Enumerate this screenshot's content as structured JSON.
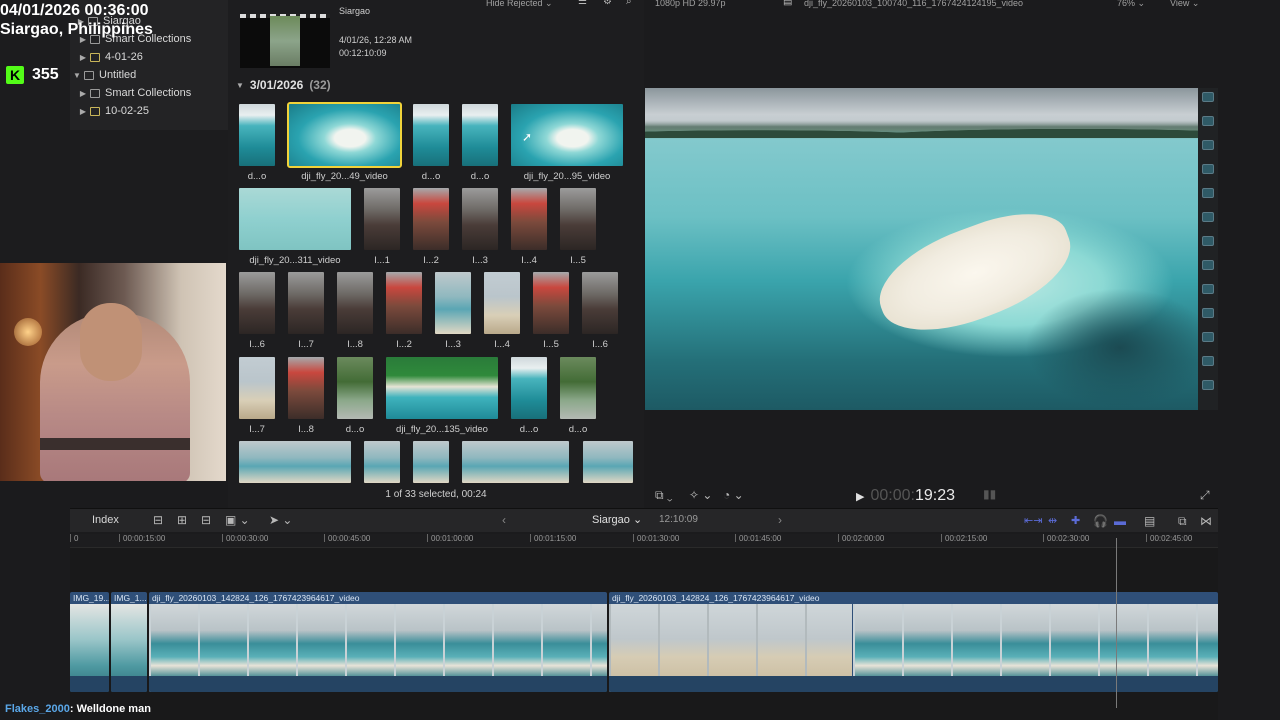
{
  "stream": {
    "date": "04/01/2026 00:36:00",
    "location": "Siargao, Philippines",
    "kick_logo": "K",
    "viewer_count": "355"
  },
  "sidebar": {
    "items": [
      {
        "label": "Siargao",
        "indent": 1
      },
      {
        "label": "Smart Collections",
        "indent": 1
      },
      {
        "label": "4-01-26",
        "indent": 1
      },
      {
        "label": "Untitled",
        "indent": 0
      },
      {
        "label": "Smart Collections",
        "indent": 1
      },
      {
        "label": "10-02-25",
        "indent": 1
      }
    ]
  },
  "browser": {
    "top_bar": {
      "hide_rejected": "Hide Rejected"
    },
    "top_clip": {
      "title": "Siargao",
      "date": "4/01/26, 12:28 AM",
      "duration": "00:12:10:09"
    },
    "date_group": {
      "label": "3/01/2026",
      "count": "(32)"
    },
    "thumbnails": [
      {
        "caption": "d...o"
      },
      {
        "caption": "dji_fly_20...49_video"
      },
      {
        "caption": "d...o"
      },
      {
        "caption": "d...o"
      },
      {
        "caption": "dji_fly_20...95_video"
      },
      {
        "caption": "dji_fly_20...311_video"
      },
      {
        "caption": "I...1"
      },
      {
        "caption": "I...2"
      },
      {
        "caption": "I...3"
      },
      {
        "caption": "I...4"
      },
      {
        "caption": "I...5"
      },
      {
        "caption": "I...6"
      },
      {
        "caption": "I...7"
      },
      {
        "caption": "I...8"
      },
      {
        "caption": "I...2"
      },
      {
        "caption": "I...3"
      },
      {
        "caption": "I...4"
      },
      {
        "caption": "I...5"
      },
      {
        "caption": "I...6"
      },
      {
        "caption": "I...7"
      },
      {
        "caption": "I...8"
      },
      {
        "caption": "d...o"
      },
      {
        "caption": "dji_fly_20...135_video"
      },
      {
        "caption": "d...o"
      },
      {
        "caption": "d...o"
      }
    ],
    "selection_status": "1 of 33 selected, 00:24"
  },
  "viewer": {
    "format": "1080p HD 29.97p",
    "clip_name": "dji_fly_20260103_100740_116_1767424124195_video",
    "zoom": "76%",
    "view_label": "View",
    "timecode_dim": "00:00:",
    "timecode": "19:23"
  },
  "timeline": {
    "index_label": "Index",
    "project_name": "Siargao",
    "project_duration": "12:10:09",
    "ruler": [
      "0",
      "00:00:15:00",
      "00:00:30:00",
      "00:00:45:00",
      "00:01:00:00",
      "00:01:15:00",
      "00:01:30:00",
      "00:01:45:00",
      "00:02:00:00",
      "00:02:15:00",
      "00:02:30:00",
      "00:02:45:00"
    ],
    "clips": [
      {
        "label": "IMG_19..."
      },
      {
        "label": "IMG_1..."
      },
      {
        "label": "dji_fly_20260103_142824_126_1767423964617_video"
      },
      {
        "label": "dji_fly_20260103_142824_126_1767423964617_video"
      }
    ]
  },
  "chat": {
    "user": "Flakes_2000",
    "message": ": Welldone man"
  },
  "colors": {
    "accent_selection": "#f1d33a",
    "clip_blue": "#2f4f78",
    "kick_green": "#53fc18"
  }
}
